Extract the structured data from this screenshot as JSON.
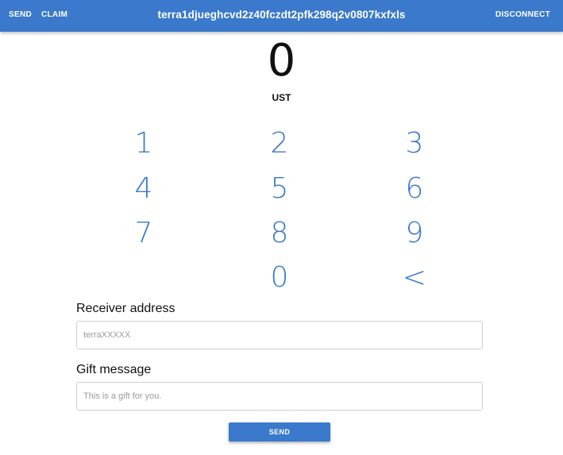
{
  "header": {
    "send_label": "SEND",
    "claim_label": "CLAIM",
    "wallet_address": "terra1djueghcvd2z40fczdt2pfk298q2v0807kxfxls",
    "disconnect_label": "DISCONNECT",
    "background_color": "#3a79cc"
  },
  "amount": {
    "value": "0",
    "currency": "UST"
  },
  "keypad": {
    "keys": [
      "1",
      "2",
      "3",
      "4",
      "5",
      "6",
      "7",
      "8",
      "9",
      "0",
      "<"
    ],
    "key_color": "#3a79cc"
  },
  "form": {
    "receiver_label": "Receiver address",
    "receiver_placeholder": "terraXXXXX",
    "receiver_value": "",
    "gift_label": "Gift message",
    "gift_placeholder": "This is a gift for you.",
    "gift_value": "",
    "send_button_label": "SEND"
  }
}
